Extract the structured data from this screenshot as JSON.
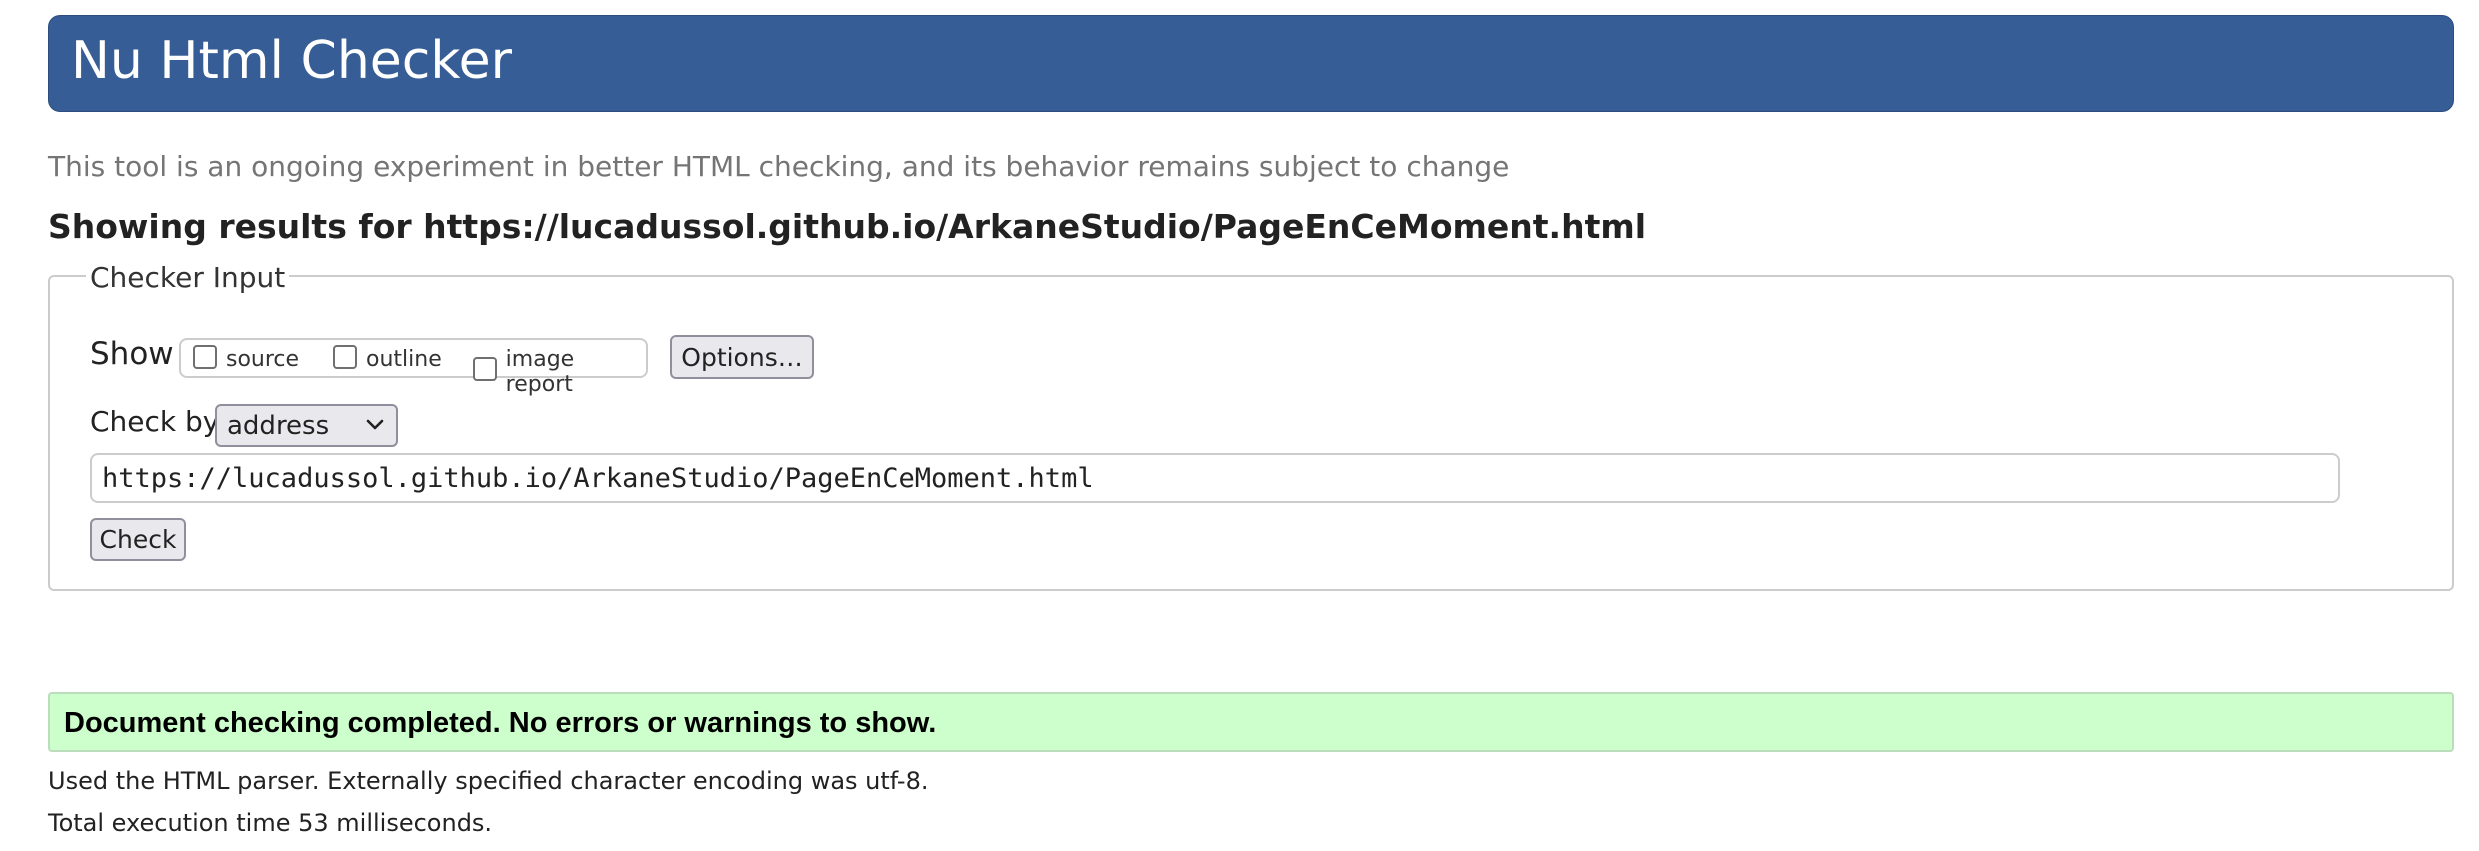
{
  "header": {
    "title": "Nu Html Checker"
  },
  "notice": "This tool is an ongoing experiment in better HTML checking, and its behavior remains subject to change",
  "results_heading": "Showing results for https://lucadussol.github.io/ArkaneStudio/PageEnCeMoment.html",
  "checker_input": {
    "legend": "Checker Input",
    "show_label": "Show",
    "show_options": [
      {
        "label": "source",
        "checked": false
      },
      {
        "label": "outline",
        "checked": false
      },
      {
        "label": "image report",
        "checked": false
      }
    ],
    "options_button": "Options…",
    "check_by_label": "Check by",
    "check_by_selected": "address",
    "url_value": "https://lucadussol.github.io/ArkaneStudio/PageEnCeMoment.html",
    "check_button": "Check"
  },
  "result": {
    "message": "Document checking completed. No errors or warnings to show.",
    "parser_info": "Used the HTML parser. Externally specified character encoding was utf-8.",
    "execution_time": "Total execution time 53 milliseconds."
  },
  "colors": {
    "header_bg": "#365d95",
    "success_bg": "#ccffcc"
  }
}
